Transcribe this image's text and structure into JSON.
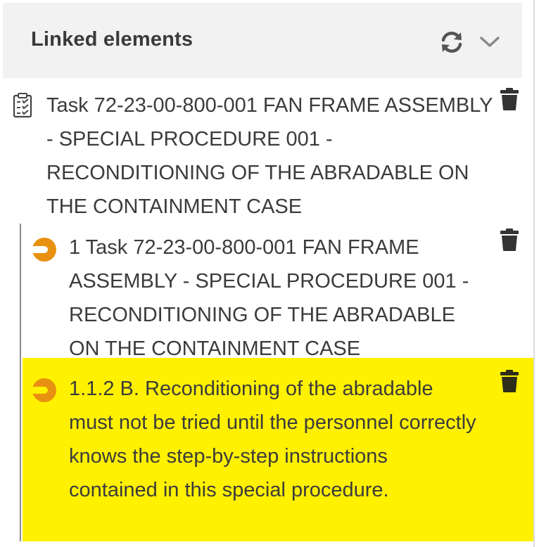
{
  "header": {
    "title": "Linked elements",
    "refresh_icon": "refresh-icon",
    "collapse_icon": "chevron-down-icon"
  },
  "items": [
    {
      "icon": "checklist-clipboard-icon",
      "text": "Task 72-23-00-800-001 FAN FRAME ASSEMBLY - SPECIAL PROCEDURE 001 - RECONDITIONING OF THE ABRADABLE ON THE CONTAINMENT CASE",
      "delete_icon": "trash-icon"
    },
    {
      "icon": "step-half-circle-icon",
      "text": "1 Task 72-23-00-800-001 FAN FRAME ASSEMBLY - SPECIAL PROCEDURE 001 - RECONDITIONING OF THE ABRADABLE ON THE CONTAINMENT CASE",
      "delete_icon": "trash-icon"
    },
    {
      "icon": "step-half-circle-icon",
      "text": "1.1.2 B. Reconditioning of the abradable must not be tried until the personnel correctly knows the step-by-step instructions contained in this special procedure.",
      "delete_icon": "trash-icon",
      "highlighted": true
    }
  ],
  "colors": {
    "header_bg": "#f2f2f2",
    "highlight": "#fff100",
    "step_icon": "#e8900f",
    "trash": "#333333",
    "text": "#3b3b3b"
  }
}
